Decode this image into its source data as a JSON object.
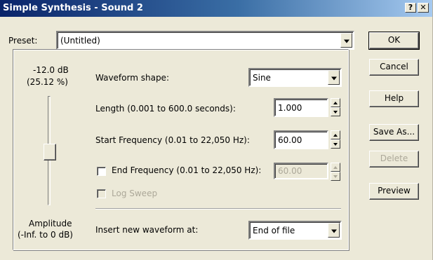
{
  "window": {
    "title": "Simple Synthesis - Sound 2",
    "help_glyph": "?",
    "close_glyph": "✕"
  },
  "preset": {
    "label": "Preset:",
    "value": "(Untitled)"
  },
  "amplitude": {
    "db_readout": "-12.0 dB",
    "percent_readout": "(25.12 %)",
    "label_line1": "Amplitude",
    "label_line2": "(-Inf. to 0 dB)"
  },
  "waveform": {
    "label": "Waveform shape:",
    "value": "Sine"
  },
  "length": {
    "label": "Length (0.001 to 600.0 seconds):",
    "value": "1.000"
  },
  "start_frequency": {
    "label": "Start Frequency (0.01 to 22,050 Hz):",
    "value": "60.00"
  },
  "end_frequency": {
    "label": "End Frequency (0.01 to 22,050 Hz):",
    "value": "60.00",
    "checked": false
  },
  "log_sweep": {
    "label": "Log Sweep",
    "checked": false
  },
  "insert_at": {
    "label": "Insert new waveform at:",
    "value": "End of file"
  },
  "buttons": {
    "ok": "OK",
    "cancel": "Cancel",
    "help": "Help",
    "save_as": "Save As...",
    "delete": "Delete",
    "preview": "Preview"
  },
  "colors": {
    "titlebar_start": "#0a246a",
    "titlebar_end": "#a6caf0",
    "dialog_bg": "#ece9d8",
    "disabled_text": "#aca899"
  }
}
